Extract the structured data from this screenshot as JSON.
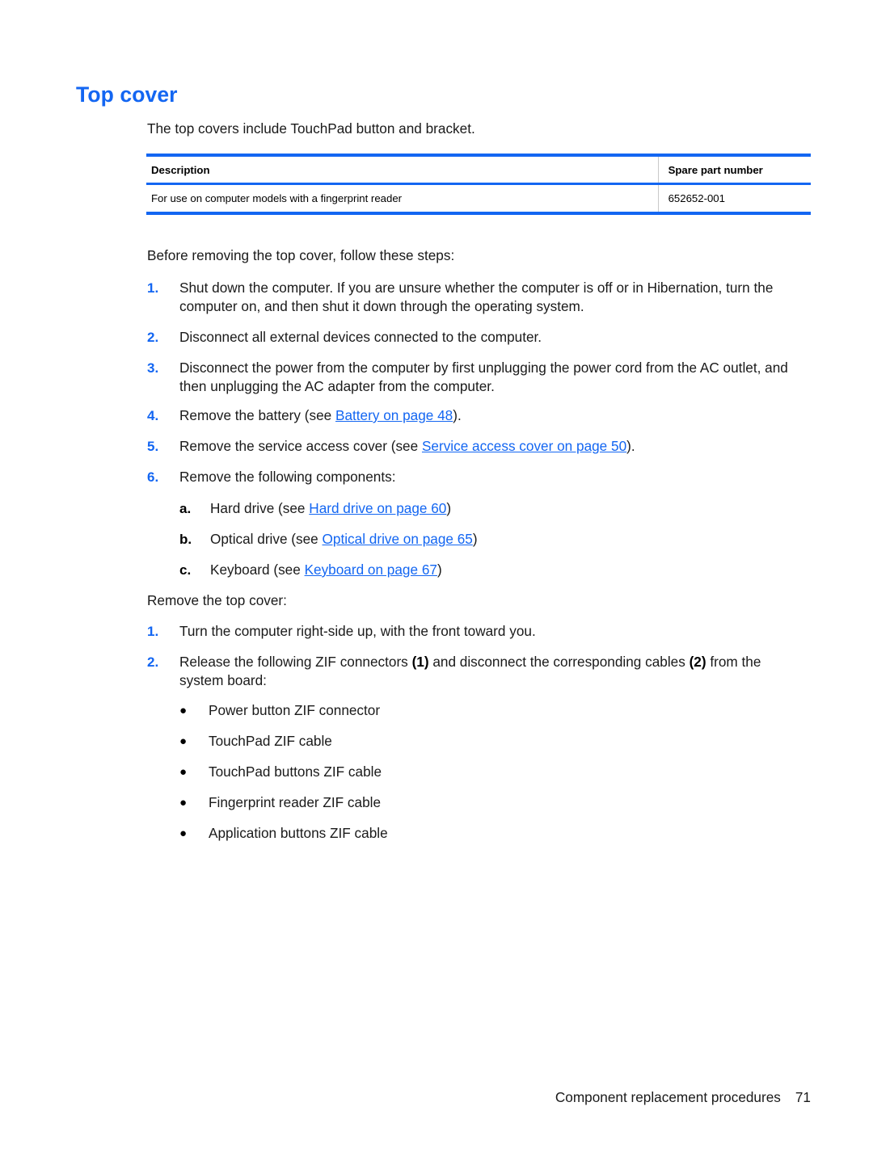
{
  "document": {
    "heading": "Top cover",
    "intro": "The top covers include TouchPad button and bracket."
  },
  "parts_table": {
    "headers": [
      "Description",
      "Spare part number"
    ],
    "rows": [
      {
        "description": "For use on computer models with a fingerprint reader",
        "spare_part_number": "652652-001"
      }
    ]
  },
  "before_section": {
    "lead": "Before removing the top cover, follow these steps:",
    "steps": [
      {
        "marker": "1.",
        "text": "Shut down the computer. If you are unsure whether the computer is off or in Hibernation, turn the computer on, and then shut it down through the operating system."
      },
      {
        "marker": "2.",
        "text": "Disconnect all external devices connected to the computer."
      },
      {
        "marker": "3.",
        "text": "Disconnect the power from the computer by first unplugging the power cord from the AC outlet, and then unplugging the AC adapter from the computer."
      },
      {
        "marker": "4.",
        "text_before": "Remove the battery (see ",
        "link": "Battery on page 48",
        "text_after": ")."
      },
      {
        "marker": "5.",
        "text_before": "Remove the service access cover (see ",
        "link": "Service access cover on page 50",
        "text_after": ")."
      },
      {
        "marker": "6.",
        "text": "Remove the following components:"
      }
    ],
    "substeps": [
      {
        "marker": "a.",
        "text_before": "Hard drive (see ",
        "link": "Hard drive on page 60",
        "text_after": ")"
      },
      {
        "marker": "b.",
        "text_before": "Optical drive (see ",
        "link": "Optical drive on page 65",
        "text_after": ")"
      },
      {
        "marker": "c.",
        "text_before": "Keyboard (see ",
        "link": "Keyboard on page 67",
        "text_after": ")"
      }
    ]
  },
  "remove_section": {
    "lead": "Remove the top cover:",
    "steps": [
      {
        "marker": "1.",
        "text": "Turn the computer right-side up, with the front toward you."
      },
      {
        "marker": "2.",
        "text_part1": "Release the following ZIF connectors ",
        "bold1": "(1)",
        "text_part2": " and disconnect the corresponding cables ",
        "bold2": "(2)",
        "text_part3": " from the system board:"
      }
    ],
    "bullets": [
      {
        "marker": "●",
        "text": "Power button ZIF connector"
      },
      {
        "marker": "●",
        "text": "TouchPad ZIF cable"
      },
      {
        "marker": "●",
        "text": "TouchPad buttons ZIF cable"
      },
      {
        "marker": "●",
        "text": "Fingerprint reader ZIF cable"
      },
      {
        "marker": "●",
        "text": "Application buttons ZIF cable"
      }
    ]
  },
  "footer": {
    "label": "Component replacement procedures",
    "page_number": "71"
  },
  "colors": {
    "accent_blue": "#1366f2",
    "link_blue": "#1366f2",
    "text_black": "#1a1a1a",
    "table_divider": "#c9c9c9"
  }
}
